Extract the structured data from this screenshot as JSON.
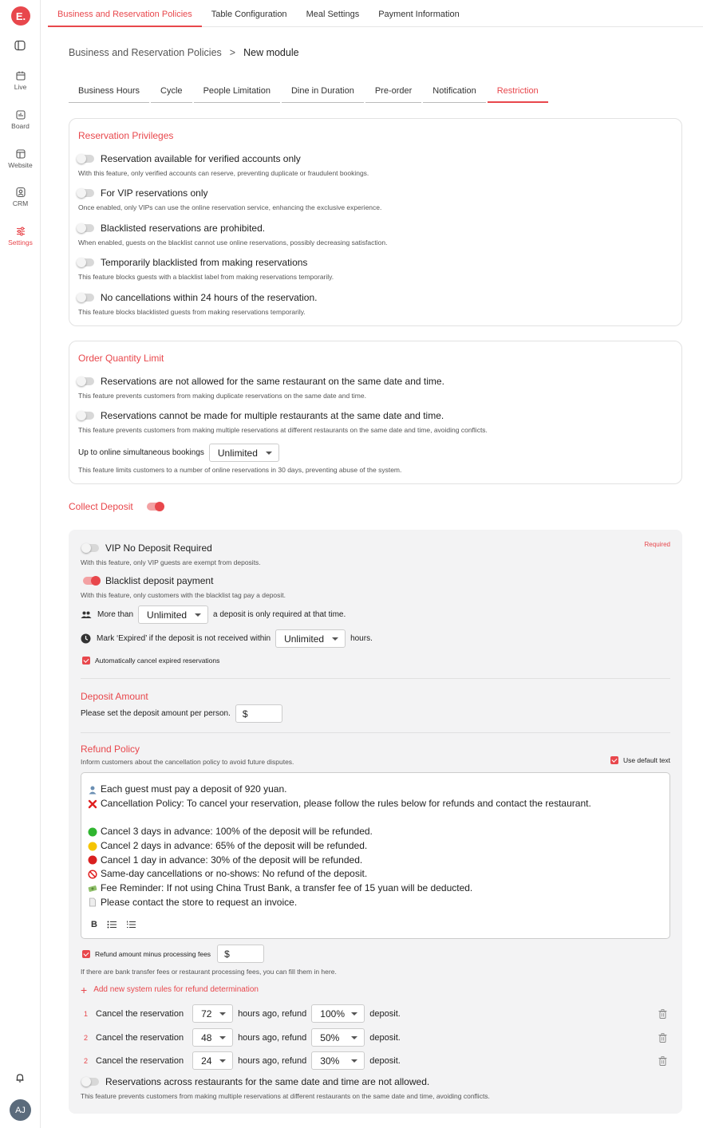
{
  "app": {
    "logo_letter": "E.",
    "brand_color": "#e8474c"
  },
  "sidebar": {
    "items": [
      {
        "label": "Live",
        "icon": "calendar-icon"
      },
      {
        "label": "Board",
        "icon": "board-icon"
      },
      {
        "label": "Website",
        "icon": "website-icon"
      },
      {
        "label": "CRM",
        "icon": "crm-icon"
      },
      {
        "label": "Settings",
        "icon": "settings-icon",
        "active": true
      }
    ],
    "avatar": "AJ"
  },
  "top_tabs": [
    {
      "label": "Business and Reservation Policies",
      "active": true
    },
    {
      "label": "Table Configuration"
    },
    {
      "label": "Meal Settings"
    },
    {
      "label": "Payment Information"
    }
  ],
  "breadcrumb": {
    "parent": "Business and Reservation Policies",
    "separator": ">",
    "current": "New module"
  },
  "sub_tabs": [
    {
      "label": "Business Hours"
    },
    {
      "label": "Cycle"
    },
    {
      "label": "People Limitation"
    },
    {
      "label": "Dine in Duration"
    },
    {
      "label": "Pre-order"
    },
    {
      "label": "Notification"
    },
    {
      "label": "Restriction",
      "active": true
    }
  ],
  "reservation_privileges": {
    "title": "Reservation Privileges",
    "options": [
      {
        "label": "Reservation available for verified accounts only",
        "desc": "With this feature, only verified accounts can reserve, preventing duplicate or fraudulent bookings.",
        "on": false
      },
      {
        "label": "For VIP reservations only",
        "desc": "Once enabled, only VIPs can use the online reservation service, enhancing the exclusive experience.",
        "on": false
      },
      {
        "label": "Blacklisted reservations are prohibited.",
        "desc": "When enabled, guests on the blacklist cannot use online reservations, possibly decreasing satisfaction.",
        "on": false
      },
      {
        "label": "Temporarily blacklisted from making reservations",
        "desc": "This feature blocks guests with a blacklist label from making reservations temporarily.",
        "on": false
      },
      {
        "label": "No cancellations within 24 hours of the reservation.",
        "desc": "This feature blocks blacklisted guests from making reservations temporarily.",
        "on": false
      }
    ]
  },
  "order_quantity": {
    "title": "Order Quantity Limit",
    "options": [
      {
        "label": "Reservations are not allowed for the same restaurant on the same date and time.",
        "desc": "This feature prevents customers from making duplicate reservations on the same date and time.",
        "on": false
      },
      {
        "label": "Reservations cannot be made for multiple restaurants at the same date and time.",
        "desc": "This feature prevents customers from making multiple reservations at different restaurants on the same date and time, avoiding conflicts.",
        "on": false
      }
    ],
    "simultaneous_label": "Up to online simultaneous bookings",
    "simultaneous_value": "Unlimited",
    "simultaneous_desc": "This feature limits customers to a number of online reservations in 30 days, preventing abuse of the system."
  },
  "collect_deposit": {
    "title": "Collect Deposit",
    "on": true,
    "required_label": "Required",
    "vip": {
      "label": "VIP No Deposit Required",
      "desc": "With this feature, only VIP guests are exempt from deposits.",
      "on": false
    },
    "blacklist": {
      "label": "Blacklist deposit payment",
      "desc": "With this feature, only customers with the blacklist tag pay a deposit.",
      "on": true
    },
    "more_than": {
      "prefix": "More than",
      "value": "Unlimited",
      "suffix": "a deposit is only required at that time."
    },
    "expired": {
      "prefix": "Mark ‘Expired’ if the deposit is not received within",
      "value": "Unlimited",
      "suffix": "hours."
    },
    "auto_cancel": "Automatically cancel expired reservations",
    "deposit_amount": {
      "title": "Deposit Amount",
      "label": "Please set the deposit amount per person.",
      "currency": "$"
    },
    "refund_policy": {
      "title": "Refund Policy",
      "desc": "Inform customers about the cancellation policy to avoid future disputes.",
      "use_default": "Use default text",
      "lines": [
        {
          "icon": "person-emoji",
          "text": "Each guest must pay a deposit of 920 yuan."
        },
        {
          "icon": "cross-emoji",
          "text": "Cancellation Policy: To cancel your reservation, please follow the rules below for refunds and contact the restaurant."
        },
        {
          "icon": "",
          "text": ""
        },
        {
          "icon": "green-circle-emoji",
          "text": "Cancel 3 days in advance: 100% of the deposit will be refunded."
        },
        {
          "icon": "yellow-circle-emoji",
          "text": "Cancel 2 days in advance: 65% of the deposit will be refunded."
        },
        {
          "icon": "red-circle-emoji",
          "text": "Cancel 1 day in advance: 30% of the deposit will be refunded."
        },
        {
          "icon": "prohibited-emoji",
          "text": "Same-day cancellations or no-shows: No refund of the deposit."
        },
        {
          "icon": "money-emoji",
          "text": "Fee Reminder: If not using China Trust Bank, a transfer fee of 15 yuan will be deducted."
        },
        {
          "icon": "page-emoji",
          "text": "Please contact the store to request an invoice."
        }
      ],
      "toolbar": {
        "bold": "B"
      }
    },
    "refund_fees": {
      "label": "Refund amount minus processing fees",
      "currency": "$",
      "desc": "If there are bank transfer fees or restaurant processing fees, you can fill them in here."
    },
    "add_rule": {
      "plus": "+",
      "label": "Add new system rules for refund determination"
    },
    "rules": [
      {
        "num": "1",
        "prefix": "Cancel the reservation",
        "hours": "72",
        "middle": "hours ago, refund",
        "percent": "100%",
        "suffix": "deposit."
      },
      {
        "num": "2",
        "prefix": "Cancel the reservation",
        "hours": "48",
        "middle": "hours ago, refund",
        "percent": "50%",
        "suffix": "deposit."
      },
      {
        "num": "2",
        "prefix": "Cancel the reservation",
        "hours": "24",
        "middle": "hours ago, refund",
        "percent": "30%",
        "suffix": "deposit."
      }
    ],
    "cross_restaurant": {
      "label": "Reservations across restaurants for the same date and time are not allowed.",
      "desc": "This feature prevents customers from making multiple reservations at different restaurants on the same date and time, avoiding conflicts.",
      "on": false
    }
  }
}
